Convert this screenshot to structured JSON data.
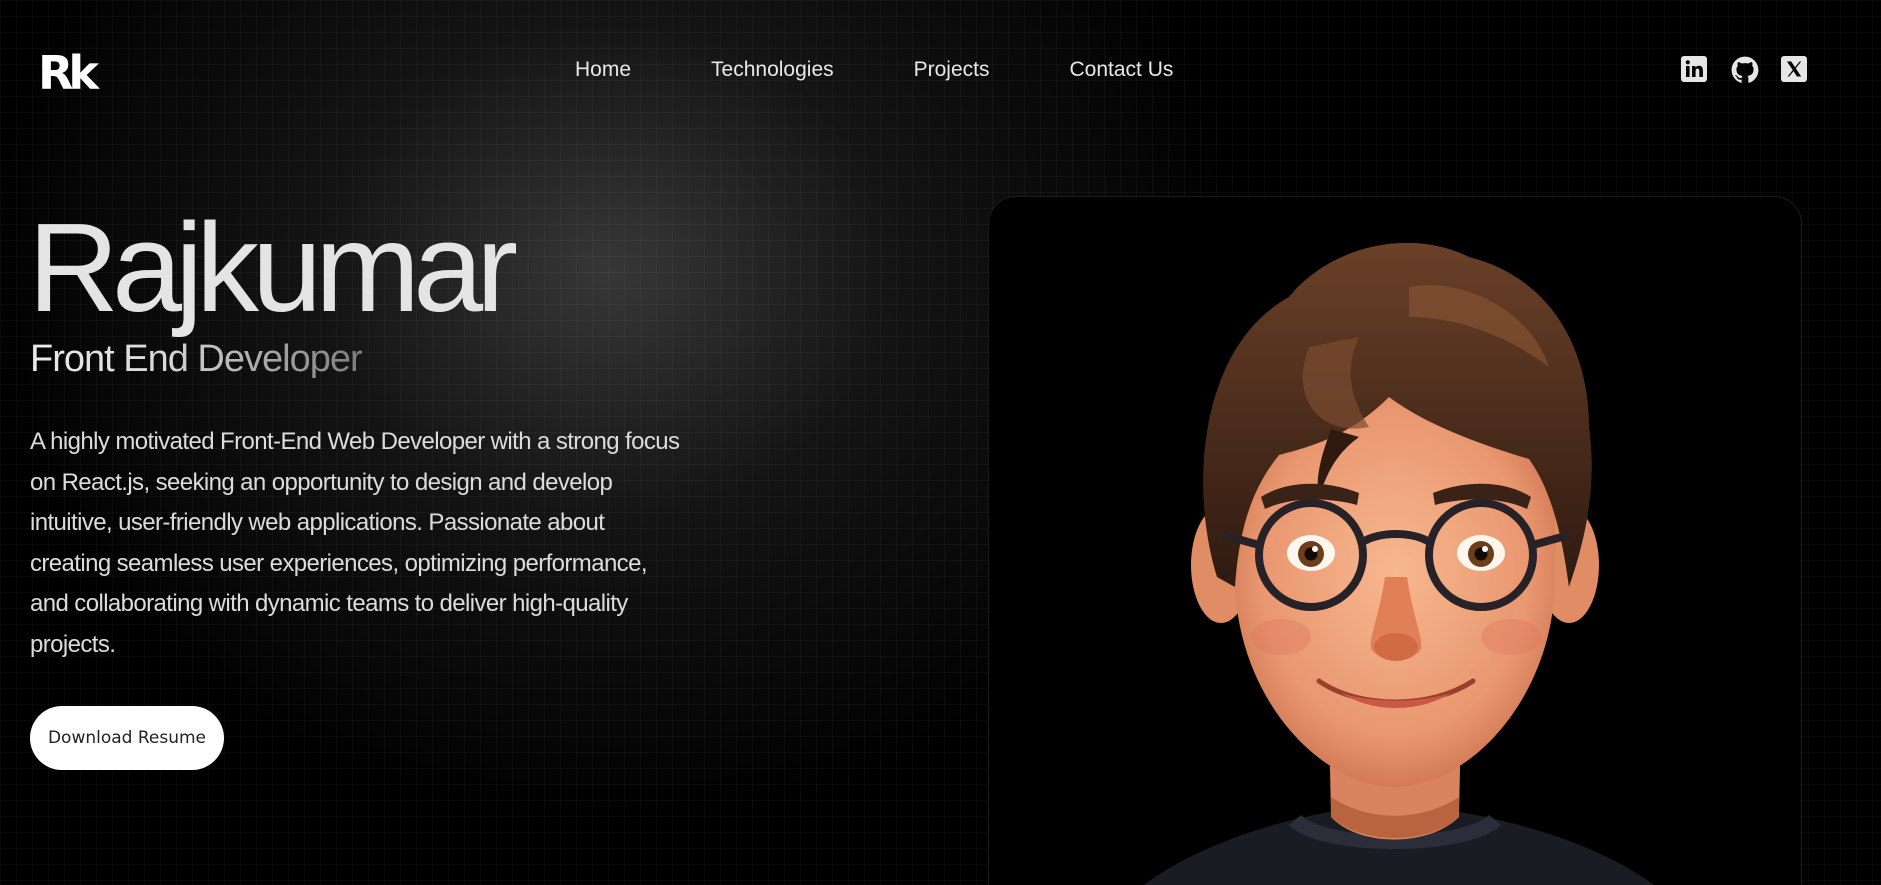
{
  "header": {
    "logo_text": "Rk",
    "nav": [
      {
        "label": "Home"
      },
      {
        "label": "Technologies"
      },
      {
        "label": "Projects"
      },
      {
        "label": "Contact Us"
      }
    ],
    "social_icons": [
      "linkedin-icon",
      "github-icon",
      "x-icon"
    ]
  },
  "hero": {
    "name": "Rajkumar",
    "role": "Front End Developer",
    "description": "A highly motivated Front-End Web Developer with a strong focus on React.js, seeking an opportunity to design and develop intuitive, user-friendly web applications. Passionate about creating seamless user experiences, optimizing performance, and collaborating with dynamic teams to deliver high-quality projects.",
    "cta_label": "Download Resume"
  },
  "portrait": {
    "icon": "cartoon-avatar-portrait"
  },
  "colors": {
    "background": "#000000",
    "text": "#e4e4e4",
    "button_bg": "#ffffff",
    "button_text": "#222222",
    "hair": "#4a2c1d",
    "skin": "#f0a07a"
  }
}
